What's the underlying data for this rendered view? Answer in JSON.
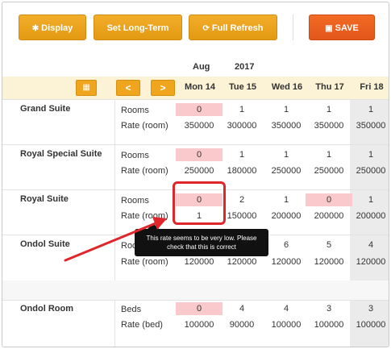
{
  "toolbar": {
    "display_label": "Display",
    "set_long_term_label": "Set Long-Term",
    "full_refresh_label": "Full Refresh",
    "save_label": "SAVE",
    "display_icon": "gear-icon",
    "refresh_icon": "refresh-icon",
    "save_icon": "floppy-disk-icon"
  },
  "calendar": {
    "month": "Aug",
    "year": "2017",
    "calendar_icon": "calendar-icon",
    "prev_label": "<",
    "next_label": ">",
    "days": [
      "Mon 14",
      "Tue 15",
      "Wed 16",
      "Thu 17",
      "Fri 18"
    ]
  },
  "rooms": [
    {
      "name": "Grand Suite",
      "rows": [
        {
          "label": "Rooms",
          "values": [
            "0",
            "1",
            "1",
            "1",
            "1"
          ]
        },
        {
          "label": "Rate (room)",
          "values": [
            "350000",
            "300000",
            "350000",
            "350000",
            "350000"
          ]
        }
      ]
    },
    {
      "name": "Royal Special Suite",
      "rows": [
        {
          "label": "Rooms",
          "values": [
            "0",
            "1",
            "1",
            "1",
            "1"
          ]
        },
        {
          "label": "Rate (room)",
          "values": [
            "250000",
            "180000",
            "250000",
            "250000",
            "250000"
          ]
        }
      ]
    },
    {
      "name": "Royal Suite",
      "rows": [
        {
          "label": "Rooms",
          "values": [
            "0",
            "2",
            "1",
            "0",
            "1"
          ]
        },
        {
          "label": "Rate (room)",
          "values": [
            "1",
            "150000",
            "200000",
            "200000",
            "200000"
          ]
        }
      ]
    },
    {
      "name": "Ondol Suite",
      "rows": [
        {
          "label": "Rooms",
          "values": [
            "",
            "",
            "6",
            "5",
            "4"
          ]
        },
        {
          "label": "Rate (room)",
          "values": [
            "120000",
            "120000",
            "120000",
            "120000",
            "120000"
          ]
        }
      ]
    },
    {
      "name": "Ondol Room",
      "rows": [
        {
          "label": "Beds",
          "values": [
            "0",
            "4",
            "4",
            "3",
            "3"
          ]
        },
        {
          "label": "Rate (bed)",
          "values": [
            "100000",
            "90000",
            "100000",
            "100000",
            "100000"
          ]
        }
      ]
    }
  ],
  "tooltip": {
    "text": "This rate seems to be very low. Please check that this is correct"
  },
  "colors": {
    "button_orange": "#f0a51f",
    "save_orange": "#e85f1f",
    "warning_pink": "#f9c9cb",
    "annotation_red": "#e0262b",
    "header_band": "#fcf2d6"
  }
}
